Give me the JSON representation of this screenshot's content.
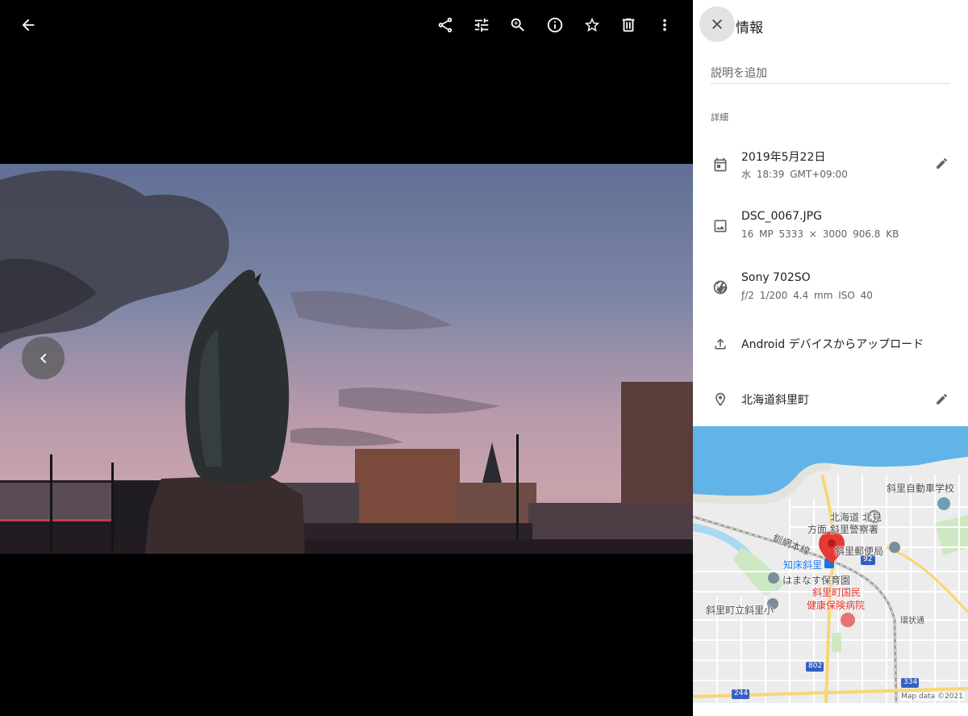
{
  "toolbar": {
    "icons": [
      "arrow-back-icon",
      "share-icon",
      "tune-icon",
      "zoom-in-icon",
      "info-icon",
      "star-icon",
      "delete-icon",
      "more-vert-icon"
    ]
  },
  "panel": {
    "title": "情報",
    "description_placeholder": "説明を追加",
    "details_heading": "詳細",
    "date": {
      "primary": "2019年5月22日",
      "secondary": "水 18:39  GMT+09:00"
    },
    "file": {
      "primary": "DSC_0067.JPG",
      "secondary": "16 MP  5333 × 3000  906.8 KB"
    },
    "camera": {
      "primary": "Sony 702SO",
      "secondary": "ƒ/2  1/200  4.4 mm  ISO 40"
    },
    "upload": {
      "primary": "Android デバイスからアップロード"
    },
    "location": {
      "primary": "北海道斜里町"
    }
  },
  "map": {
    "labels": {
      "school": "斜里自動車学校",
      "police_1": "北海道 北見",
      "police_2": "方面 斜里警察署",
      "rail_line": "釧網本線",
      "post_office": "斜里郵便局",
      "station": "知床斜里",
      "nursery": "はまなす保育園",
      "hospital_1": "斜里町国民",
      "hospital_2": "健康保険病院",
      "elementary": "斜里町立斜里小",
      "ring_road": "環状通",
      "route_92": "92",
      "route_802": "802",
      "route_334": "334",
      "route_244": "244"
    },
    "attribution": "Map data ©2021",
    "colors": {
      "sea": "#62b3e8",
      "land": "#ececec",
      "river": "#a8d8f2",
      "park": "#cde8c3",
      "pin": "#e53935"
    }
  }
}
